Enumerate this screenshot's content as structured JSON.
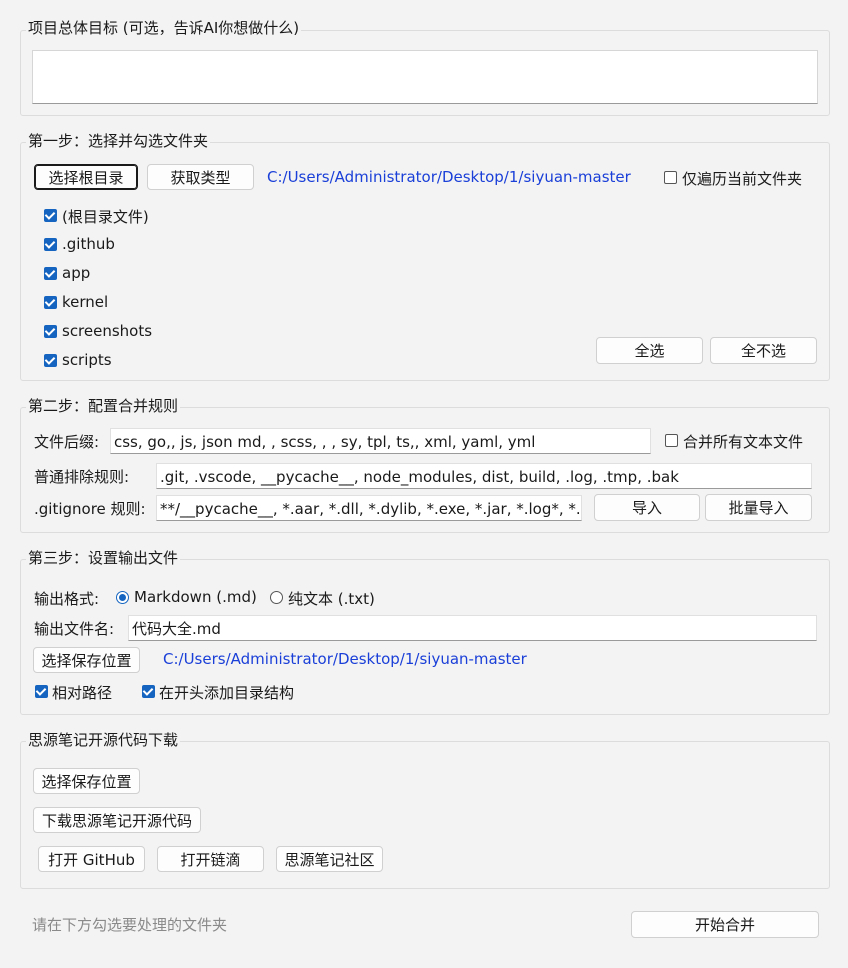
{
  "goal": {
    "legend": "项目总体目标 (可选，告诉AI你想做什么)",
    "value": ""
  },
  "step1": {
    "legend": "第一步：选择并勾选文件夹",
    "choose_root_button": "选择根目录",
    "get_types_button": "获取类型",
    "root_path": "C:/Users/Administrator/Desktop/1/siyuan-master",
    "only_current_label": "仅遍历当前文件夹",
    "only_current_checked": false,
    "folders": [
      {
        "label": "(根目录文件)",
        "checked": true
      },
      {
        "label": ".github",
        "checked": true
      },
      {
        "label": "app",
        "checked": true
      },
      {
        "label": "kernel",
        "checked": true
      },
      {
        "label": "screenshots",
        "checked": true
      },
      {
        "label": "scripts",
        "checked": true
      }
    ],
    "select_all_button": "全选",
    "select_none_button": "全不选"
  },
  "step2": {
    "legend": "第二步：配置合并规则",
    "suffix_label": "文件后缀:",
    "suffix_value": "css, go,, js, json  md, , scss, , , sy, tpl, ts,, xml, yaml, yml",
    "merge_all_label": "合并所有文本文件",
    "merge_all_checked": false,
    "exclude_label": "普通排除规则:",
    "exclude_value": ".git, .vscode, __pycache__, node_modules, dist, build, .log, .tmp, .bak",
    "gitignore_label": ".gitignore 规则:",
    "gitignore_value": "**/__pycache__, *.aar, *.dll, *.dylib, *.exe, *.jar, *.log*, *.out,",
    "import_button": "导入",
    "batch_import_button": "批量导入"
  },
  "step3": {
    "legend": "第三步：设置输出文件",
    "format_label": "输出格式:",
    "format_markdown": "Markdown (.md)",
    "format_text": "纯文本 (.txt)",
    "format_selected": "markdown",
    "filename_label": "输出文件名:",
    "filename_value": "代码大全.md",
    "choose_save_button": "选择保存位置",
    "save_path": "C:/Users/Administrator/Desktop/1/siyuan-master",
    "relative_path_label": "相对路径",
    "relative_path_checked": true,
    "add_toc_label": "在开头添加目录结构",
    "add_toc_checked": true
  },
  "download": {
    "legend": "思源笔记开源代码下载",
    "choose_save_button": "选择保存位置",
    "download_button": "下载思源笔记开源代码",
    "open_github_button": "打开 GitHub",
    "open_liandi_button": "打开链滴",
    "community_button": "思源笔记社区"
  },
  "footer": {
    "status": "请在下方勾选要处理的文件夹",
    "start_button": "开始合并"
  },
  "colors": {
    "accent": "#1565c0",
    "path_link": "#1a3fd8",
    "background": "#f3f3f3"
  }
}
